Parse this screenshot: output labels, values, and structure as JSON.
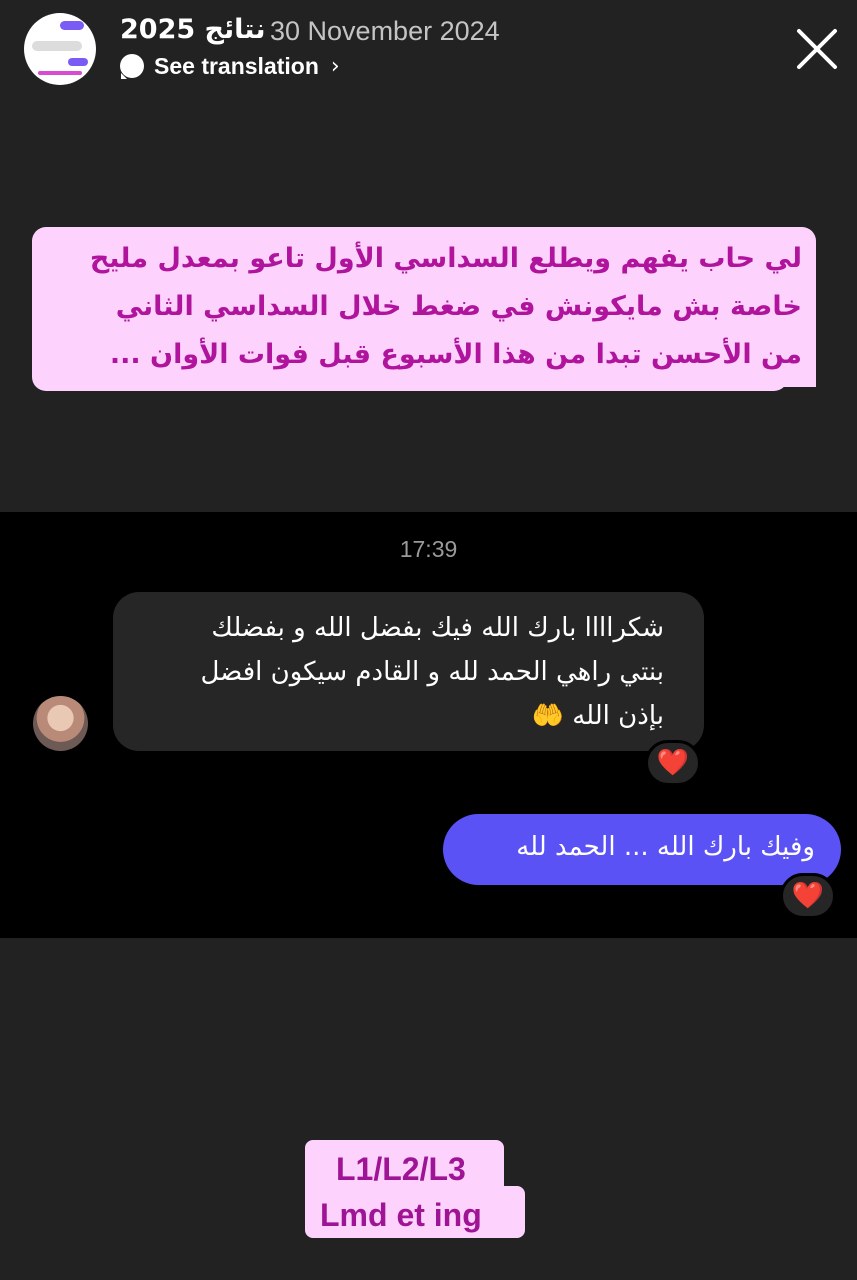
{
  "header": {
    "story_title": "نتائج 2025",
    "date": "30 November 2024",
    "see_translation": "See translation",
    "chevron": "›",
    "close_icon": "close-icon",
    "translate_icon": "chat-bubble-icon"
  },
  "caption": {
    "lines": [
      "لي حاب يفهم ويطلع السداسي الأول تاعو بمعدل مليح",
      "خاصة بش مايكونش في ضغط خلال السداسي الثاني",
      "من الأحسن تبدا من هذا الأسبوع قبل فوات الأوان ..."
    ]
  },
  "chat": {
    "timestamp": "17:39",
    "incoming": {
      "lines": [
        "شكراااا بارك الله فيك بفضل الله و بفضلك",
        "بنتي راهي الحمد لله و القادم سيكون افضل",
        "بإذن الله 🤲"
      ],
      "reaction": "❤️"
    },
    "outgoing": {
      "text": "وفيك بارك الله ... الحمد لله",
      "reaction": "❤️"
    }
  },
  "sticker": {
    "line1": "L1/L2/L3",
    "line2": "Lmd et ing"
  },
  "colors": {
    "background": "#222222",
    "chat_panel": "#000000",
    "caption_bg": "#fdd3fd",
    "caption_text": "#b0149c",
    "incoming_bubble": "#262626",
    "outgoing_bubble": "#5b52f6",
    "reaction_heart": "#ff2d43"
  }
}
